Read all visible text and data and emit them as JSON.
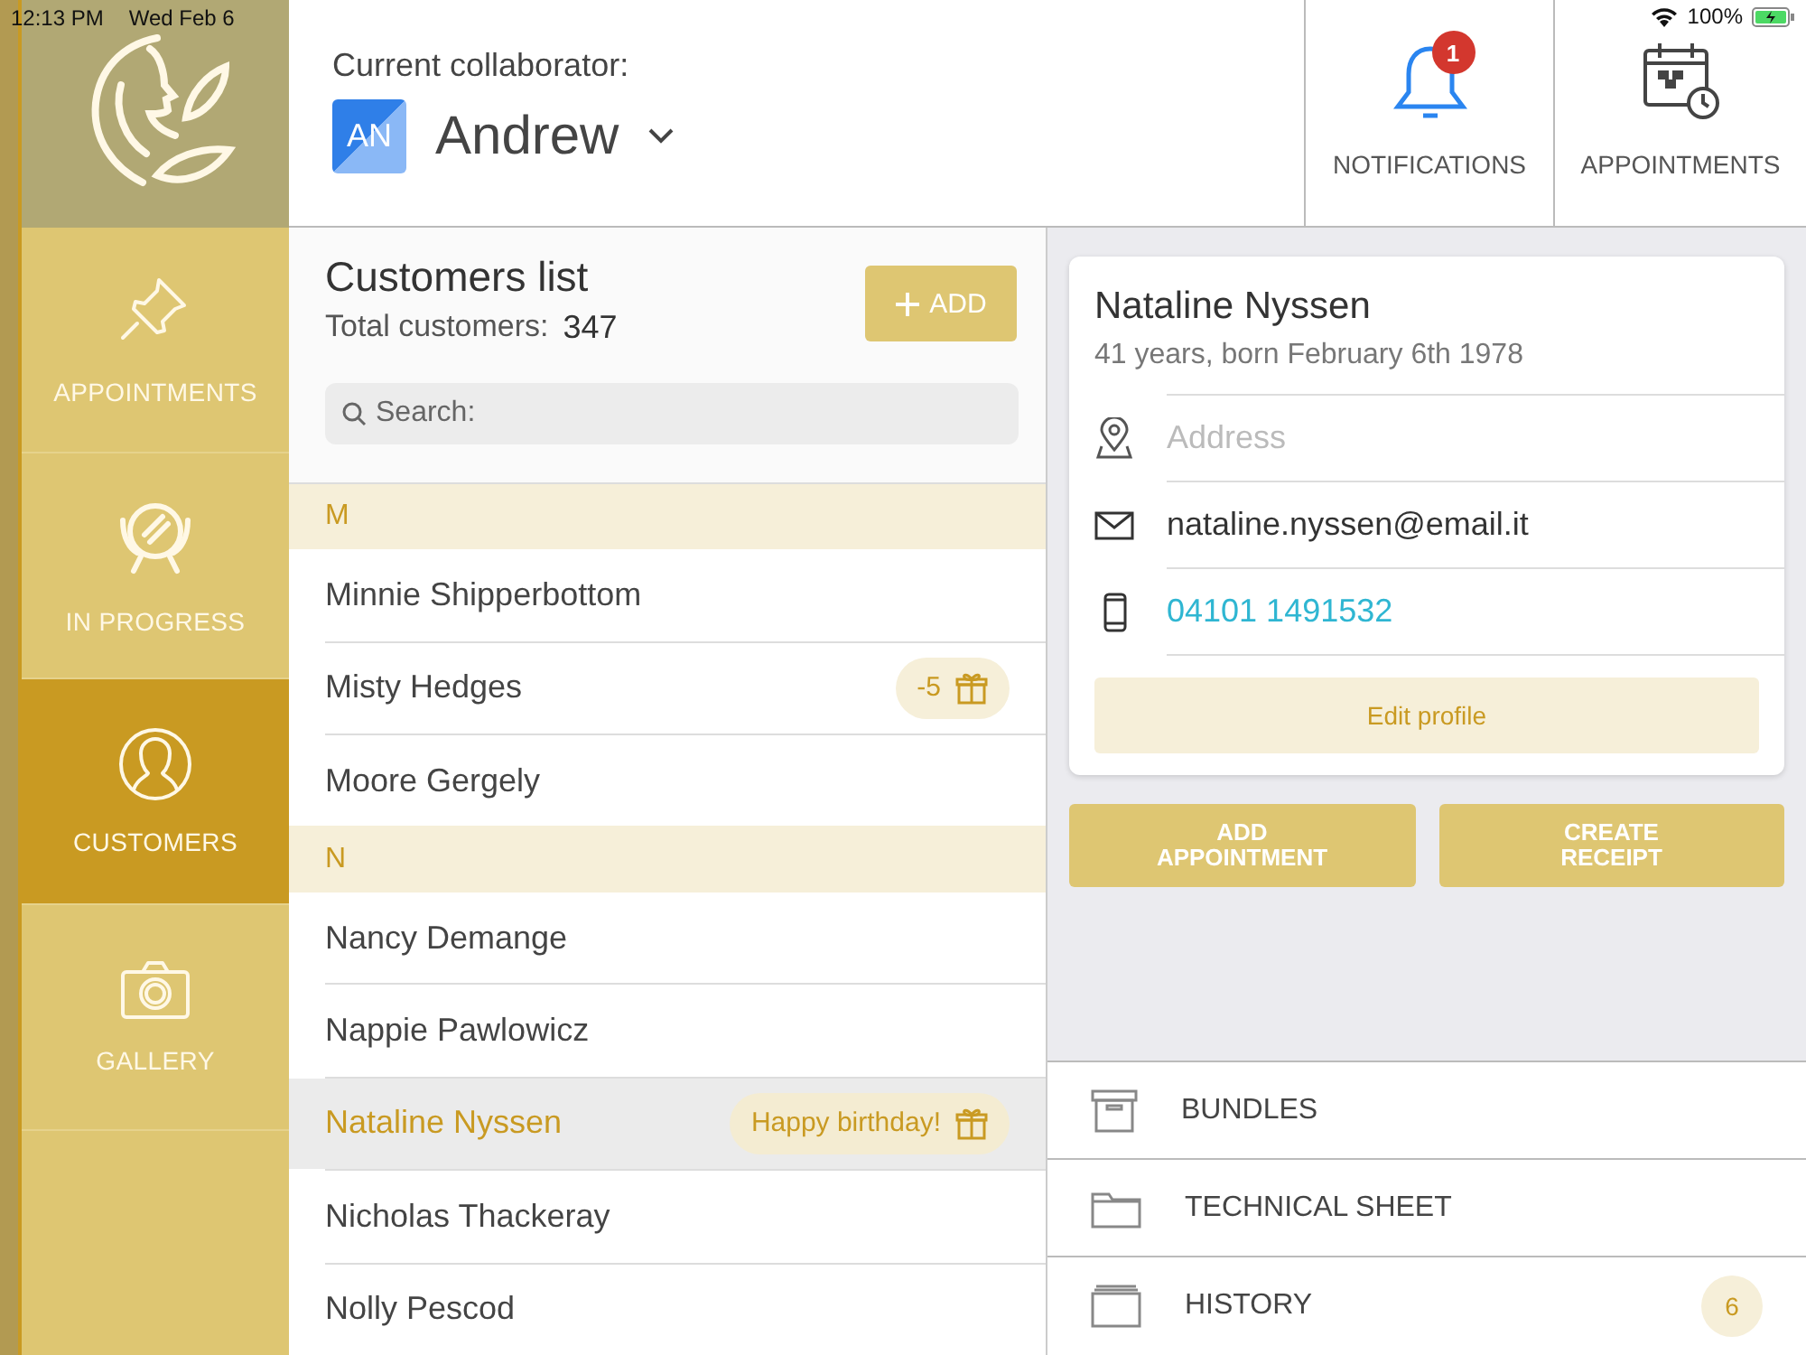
{
  "status_bar": {
    "time": "12:13 PM",
    "date": "Wed Feb 6",
    "battery": "100%"
  },
  "sidebar": {
    "items": [
      {
        "label": "APPOINTMENTS",
        "selected": false
      },
      {
        "label": "IN PROGRESS",
        "selected": false
      },
      {
        "label": "CUSTOMERS",
        "selected": true
      },
      {
        "label": "GALLERY",
        "selected": false
      }
    ]
  },
  "header": {
    "collaborator_label": "Current collaborator:",
    "avatar": "AN",
    "collaborator": "Andrew",
    "actions": [
      {
        "label": "NOTIFICATIONS",
        "badge": "1"
      },
      {
        "label": "APPOINTMENTS"
      }
    ]
  },
  "customers": {
    "title": "Customers list",
    "total_label": "Total customers:",
    "total": "347",
    "add_button": "ADD",
    "search_placeholder": "Search:",
    "sections": [
      {
        "letter": "M",
        "rows": [
          {
            "name": "Minnie Shipperbottom",
            "selected": false
          },
          {
            "name": "Misty Hedges",
            "selected": false,
            "badge": "-5"
          },
          {
            "name": "Moore Gergely",
            "selected": false
          }
        ]
      },
      {
        "letter": "N",
        "rows": [
          {
            "name": "Nancy Demange",
            "selected": false
          },
          {
            "name": "Nappie Pawlowicz",
            "selected": false
          },
          {
            "name": "Nataline Nyssen",
            "selected": true,
            "badge": "Happy birthday!"
          },
          {
            "name": "Nicholas Thackeray",
            "selected": false
          },
          {
            "name": "Nolly Pescod",
            "selected": false
          }
        ]
      }
    ]
  },
  "profile": {
    "name": "Nataline Nyssen",
    "subtitle": "41 years, born February 6th 1978",
    "fields": [
      {
        "kind": "address",
        "placeholder": "Address"
      },
      {
        "kind": "email",
        "value": "nataline.nyssen@email.it"
      },
      {
        "kind": "phone",
        "value": "04101 1491532"
      }
    ],
    "edit_button": "Edit profile",
    "buttons": [
      "ADD APPOINTMENT",
      "CREATE RECEIPT"
    ]
  },
  "menu": [
    {
      "label": "BUNDLES"
    },
    {
      "label": "TECHNICAL SHEET"
    },
    {
      "label": "HISTORY",
      "count": "6"
    }
  ]
}
